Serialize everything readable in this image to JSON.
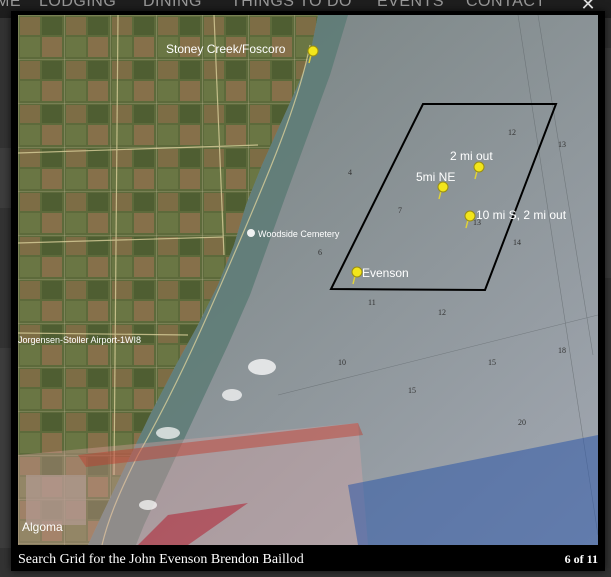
{
  "site_nav": {
    "items": [
      {
        "label": "ME"
      },
      {
        "label": "LODGING"
      },
      {
        "label": "DINING"
      },
      {
        "label": "THINGS TO DO"
      },
      {
        "label": "EVENTS"
      },
      {
        "label": "CONTACT"
      }
    ]
  },
  "lightbox": {
    "close_glyph": "✕",
    "caption": "Search Grid for the John Evenson Brendon Baillod",
    "counter": "6 of 11"
  },
  "map": {
    "places": {
      "stoney_creek": "Stoney Creek/Foscoro",
      "cemetery": "Woodside Cemetery",
      "airport": "Jorgensen-Stoller Airport-1WI8",
      "algoma": "Algoma"
    },
    "pins": [
      {
        "label": "2 mi out"
      },
      {
        "label": "5mi NE"
      },
      {
        "label": "10 mi S, 2 mi out"
      },
      {
        "label": "Evenson"
      }
    ],
    "colors": {
      "pin": "#f2e51b",
      "grid_outline": "#000000",
      "water": "#8a9aa0",
      "land": "#5f6b3a",
      "overlay_red": "#c0392b",
      "overlay_blue": "#1f4f9a"
    }
  }
}
